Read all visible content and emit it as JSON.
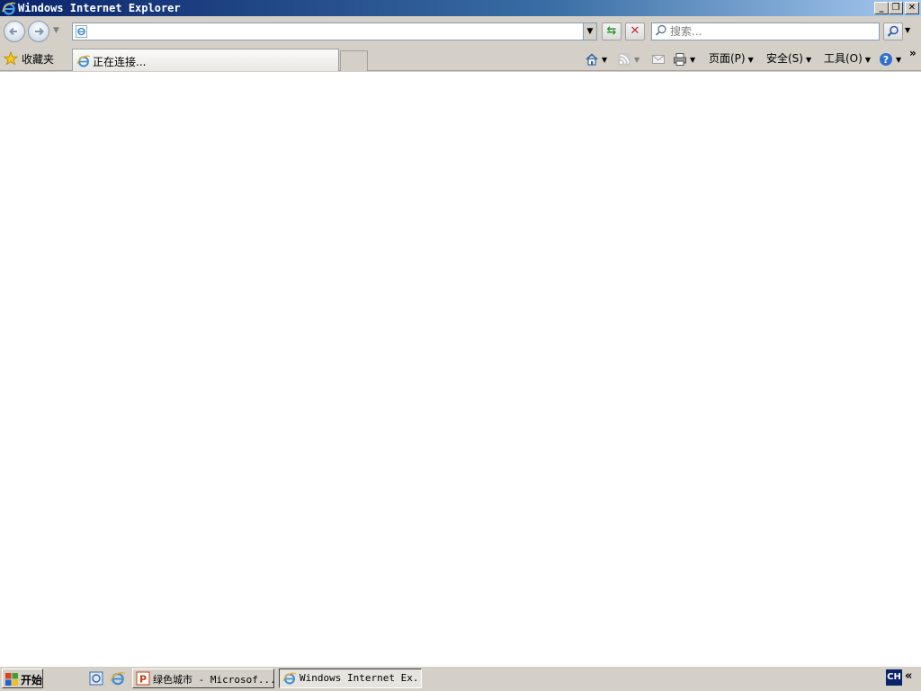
{
  "window": {
    "title": "Windows Internet Explorer",
    "controls": {
      "minimize": "_",
      "restore": "❐",
      "close": "✕"
    }
  },
  "nav": {
    "back_icon": "back-arrow-icon",
    "forward_icon": "forward-arrow-icon",
    "address_value": "",
    "refresh_icon": "refresh-icon",
    "stop_icon": "stop-icon",
    "search_placeholder": "搜索...",
    "search_icon": "search-icon"
  },
  "toolbar": {
    "favorites_label": "收藏夹",
    "tab_label": "正在连接...",
    "page_label": "页面(P)",
    "safety_label": "安全(S)",
    "tools_label": "工具(O)",
    "help_icon": "help-icon",
    "more_icon": "chevron-right-double-icon"
  },
  "taskbar": {
    "start_label": "开始",
    "tasks": [
      {
        "label": "绿色城市 - Microsof...",
        "icon": "powerpoint-icon",
        "active": false
      },
      {
        "label": "Windows Internet Ex...",
        "icon": "ie-icon",
        "active": true
      }
    ],
    "tray_lang": "CH",
    "tray_expand": "«"
  },
  "colors": {
    "titlebar_start": "#0a246a",
    "titlebar_end": "#a6caf0",
    "chrome": "#d4d0c8",
    "content": "#ffffff"
  }
}
